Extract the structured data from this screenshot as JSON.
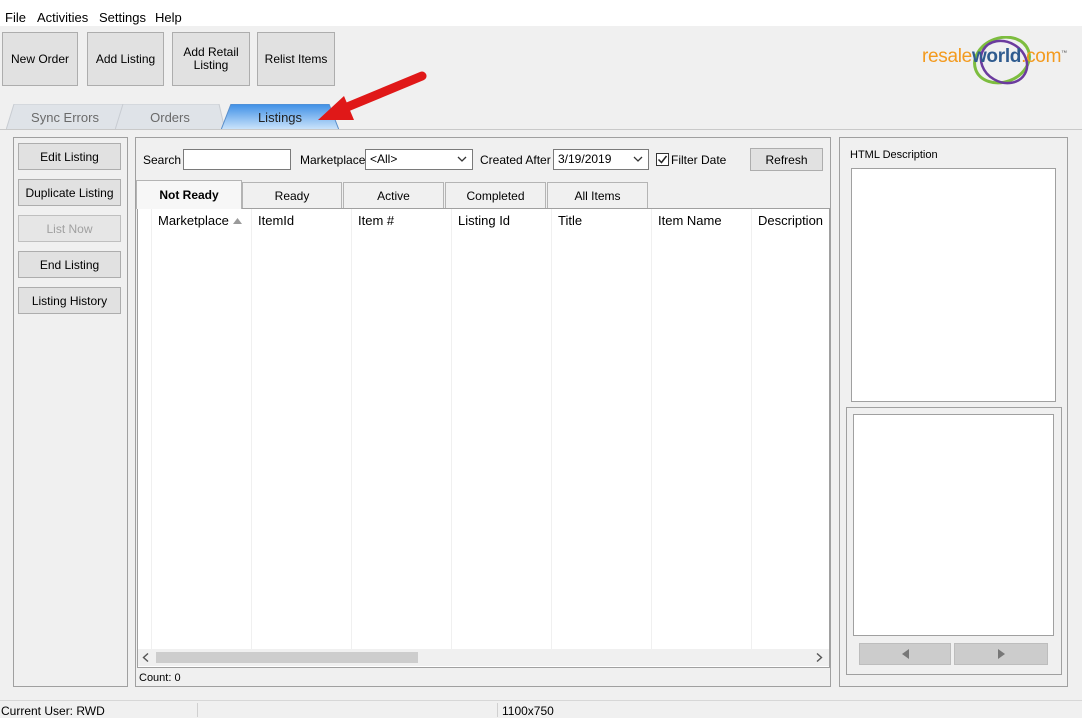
{
  "menu": [
    "File",
    "Activities",
    "Settings",
    "Help"
  ],
  "toolbar": {
    "new_order": "New Order",
    "add_listing": "Add Listing",
    "add_retail_listing": "Add Retail\nListing",
    "relist_items": "Relist Items"
  },
  "logo": {
    "resale": "resale",
    "world": "world",
    "com": ".com",
    "tm": "™"
  },
  "main_tabs": [
    {
      "label": "Sync Errors"
    },
    {
      "label": "Orders"
    },
    {
      "label": "Listings"
    }
  ],
  "left_actions": {
    "edit_listing": "Edit Listing",
    "duplicate_listing": "Duplicate Listing",
    "list_now": "List Now",
    "end_listing": "End Listing",
    "listing_history": "Listing History"
  },
  "filters": {
    "search_label": "Search",
    "search_value": "",
    "marketplace_label": "Marketplace",
    "marketplace_value": "<All>",
    "created_after_label": "Created After",
    "created_after_value": "3/19/2019",
    "filter_date_label": "Filter Date",
    "filter_date_checked": true,
    "refresh_label": "Refresh"
  },
  "sub_tabs": [
    {
      "label": "Not Ready",
      "active": true
    },
    {
      "label": "Ready"
    },
    {
      "label": "Active"
    },
    {
      "label": "Completed"
    },
    {
      "label": "All Items"
    }
  ],
  "grid": {
    "columns": [
      "Marketplace",
      "ItemId",
      "Item #",
      "Listing Id",
      "Title",
      "Item Name",
      "Description"
    ],
    "sorted_column": "Marketplace",
    "rows": []
  },
  "count_text": "Count: 0",
  "right_panel": {
    "html_description_label": "HTML Description"
  },
  "status": {
    "current_user": "Current User: RWD",
    "size": "1100x750"
  },
  "colors": {
    "active_tab": "#5aa7f0",
    "arrow": "#e01818"
  }
}
